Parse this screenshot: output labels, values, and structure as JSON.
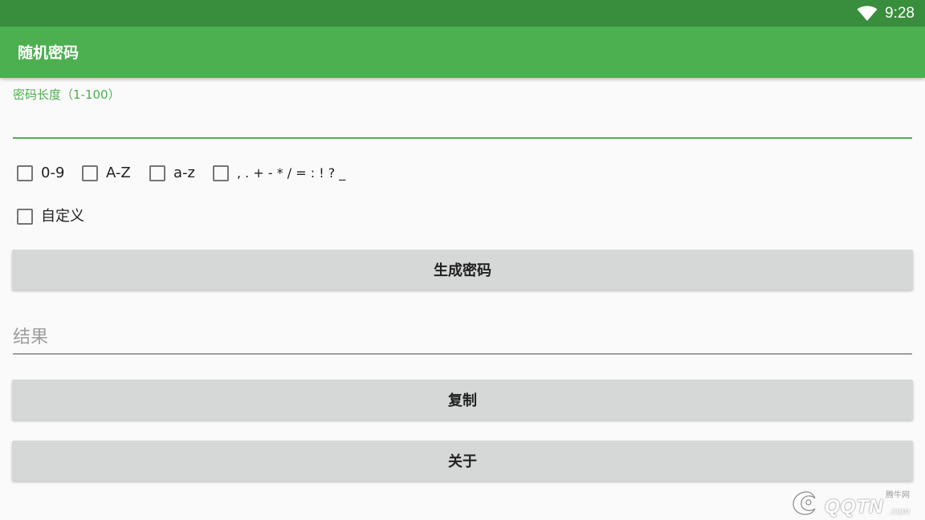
{
  "status_bar": {
    "time": "9:28",
    "wifi_icon": "wifi-icon"
  },
  "app_bar": {
    "title": "随机密码"
  },
  "length_field": {
    "label": "密码长度（1-100）",
    "value": ""
  },
  "options": {
    "digits_label": "0-9",
    "uppercase_label": "A-Z",
    "lowercase_label": "a-z",
    "symbols_label": ", . + - * / = : ! ? _",
    "custom_label": "自定义"
  },
  "buttons": {
    "generate_label": "生成密码",
    "copy_label": "复制",
    "about_label": "关于"
  },
  "result_field": {
    "placeholder": "结果",
    "value": ""
  },
  "watermark": {
    "small_text": "腾牛网",
    "brand_text": "QQTN",
    "suffix_text": ".com"
  },
  "colors": {
    "status_bar": "#388e3c",
    "app_bar": "#4caf50",
    "accent": "#4caf50",
    "button_bg": "#d6d7d7",
    "background": "#fafafa"
  }
}
